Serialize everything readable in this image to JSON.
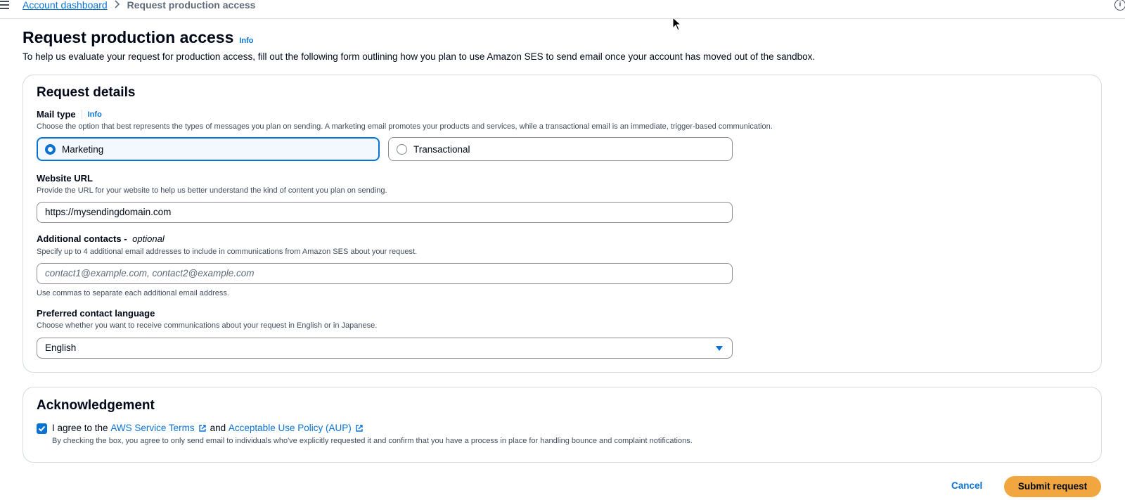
{
  "breadcrumb": {
    "items": [
      {
        "label": "Account dashboard"
      },
      {
        "label": "Request production access"
      }
    ]
  },
  "header": {
    "title": "Request production access",
    "info_label": "Info",
    "description": "To help us evaluate your request for production access, fill out the following form outlining how you plan to use Amazon SES to send email once your account has moved out of the sandbox."
  },
  "request_details": {
    "title": "Request details",
    "mail_type": {
      "label": "Mail type",
      "info_label": "Info",
      "description": "Choose the option that best represents the types of messages you plan on sending. A marketing email promotes your products and services, while a transactional email is an immediate, trigger-based communication.",
      "options": [
        {
          "label": "Marketing",
          "selected": true
        },
        {
          "label": "Transactional",
          "selected": false
        }
      ]
    },
    "website_url": {
      "label": "Website URL",
      "description": "Provide the URL for your website to help us better understand the kind of content you plan on sending.",
      "value": "https://mysendingdomain.com"
    },
    "additional_contacts": {
      "label": "Additional contacts - ",
      "optional_label": "optional",
      "description": "Specify up to 4 additional email addresses to include in communications from Amazon SES about your request.",
      "placeholder": "contact1@example.com, contact2@example.com",
      "hint": "Use commas to separate each additional email address."
    },
    "preferred_language": {
      "label": "Preferred contact language",
      "description": "Choose whether you want to receive communications about your request in English or in Japanese.",
      "selected": "English"
    }
  },
  "acknowledgement": {
    "title": "Acknowledgement",
    "checked": true,
    "prefix": "I agree to the",
    "terms_link": "AWS Service Terms",
    "conjunction": "and",
    "aup_link": "Acceptable Use Policy (AUP)",
    "description": "By checking the box, you agree to only send email to individuals who've explicitly requested it and confirm that you have a process in place for handling bounce and complaint notifications."
  },
  "actions": {
    "cancel_label": "Cancel",
    "submit_label": "Submit request"
  },
  "colors": {
    "link": "#0972d3",
    "primary_button": "#f2a63f"
  }
}
